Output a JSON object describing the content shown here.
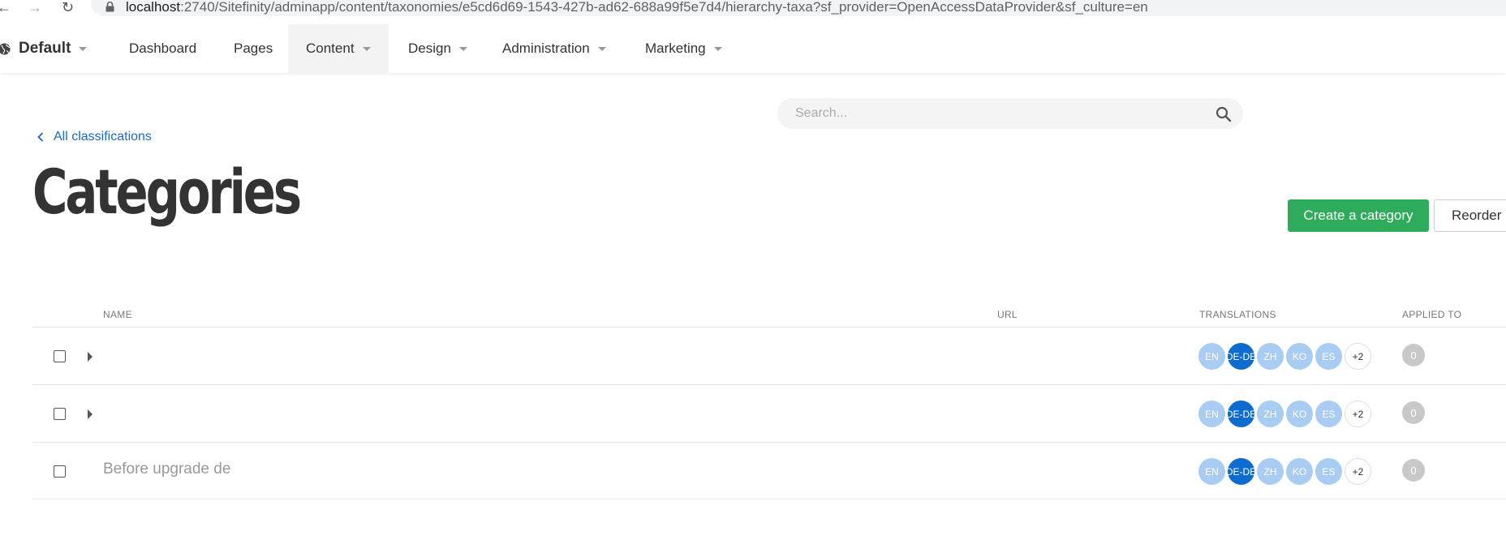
{
  "browser": {
    "back_glyph": "←",
    "forward_glyph": "→",
    "reload_glyph": "↻",
    "url_host": "localhost",
    "url_rest": ":2740/Sitefinity/adminapp/content/taxonomies/e5cd6d69-1543-427b-ad62-688a99f5e7d4/hierarchy-taxa?sf_provider=OpenAccessDataProvider&sf_culture=en"
  },
  "site": {
    "label": "Default",
    "icon": "globe-icon"
  },
  "nav": {
    "dashboard": "Dashboard",
    "pages": "Pages",
    "content": "Content",
    "design": "Design",
    "administration": "Administration",
    "marketing": "Marketing"
  },
  "search": {
    "placeholder": "Search...",
    "icon": "search-icon"
  },
  "breadcrumb": {
    "label": "All classifications"
  },
  "page": {
    "title": "Categories"
  },
  "actions": {
    "create": "Create a category",
    "reorder": "Reorder"
  },
  "table": {
    "headers": {
      "name": "NAME",
      "url": "URL",
      "translations": "TRANSLATIONS",
      "applied_to": "APPLIED TO"
    },
    "rows": [
      {
        "name": "",
        "expandable": true,
        "languages": [
          "EN",
          "DE-DE",
          "ZH",
          "KO",
          "ES"
        ],
        "current_language": "DE-DE",
        "more": "+2",
        "applied_to": "0"
      },
      {
        "name": "",
        "expandable": true,
        "languages": [
          "EN",
          "DE-DE",
          "ZH",
          "KO",
          "ES"
        ],
        "current_language": "DE-DE",
        "more": "+2",
        "applied_to": "0"
      },
      {
        "name": "Before upgrade de",
        "expandable": false,
        "languages": [
          "EN",
          "DE-DE",
          "ZH",
          "KO",
          "ES"
        ],
        "current_language": "DE-DE",
        "more": "+2",
        "applied_to": "0"
      }
    ]
  },
  "colors": {
    "primary_button": "#2eab5b",
    "link": "#1b6ac9",
    "current_language": "#0f6ccf",
    "language": "#a9cdf2"
  }
}
